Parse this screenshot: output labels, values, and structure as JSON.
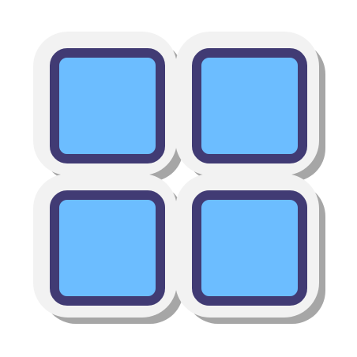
{
  "icon": {
    "name": "grid-view-icon",
    "style": "sticker",
    "colors": {
      "shadow": "#a6a6a6",
      "sticker_border": "#f2f2f2",
      "tile_fill": "#6cbdff",
      "tile_outline": "#413b74",
      "background": "#ffffff"
    }
  }
}
